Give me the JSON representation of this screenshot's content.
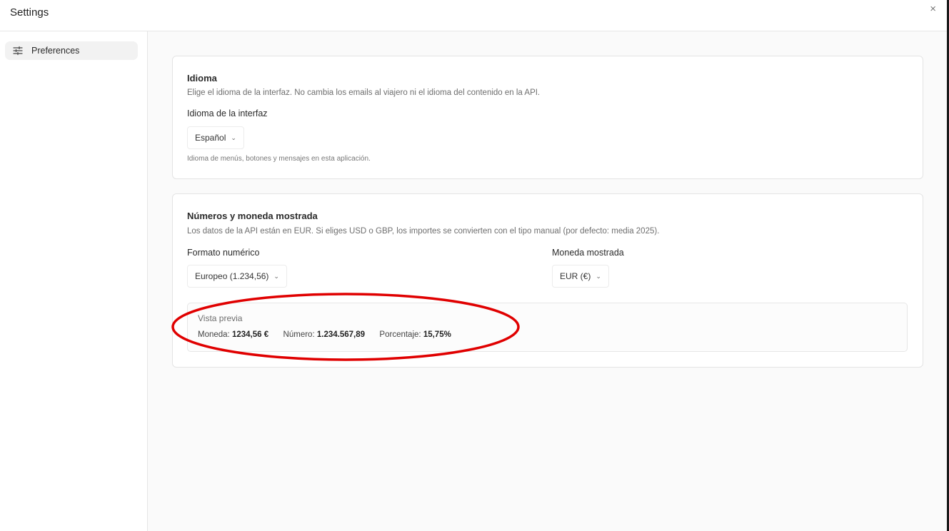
{
  "header": {
    "title": "Settings",
    "close_glyph": "×"
  },
  "sidebar": {
    "items": [
      {
        "label": "Preferences",
        "icon": "sliders-icon"
      }
    ]
  },
  "idioma": {
    "title": "Idioma",
    "description": "Elige el idioma de la interfaz. No cambia los emails al viajero ni el idioma del contenido en la API.",
    "field_label": "Idioma de la interfaz",
    "selected": "Español",
    "hint": "Idioma de menús, botones y mensajes en esta aplicación."
  },
  "numeros": {
    "title": "Números y moneda mostrada",
    "description": "Los datos de la API están en EUR. Si eliges USD o GBP, los importes se convierten con el tipo manual (por defecto: media 2025).",
    "format_label": "Formato numérico",
    "format_selected": "Europeo (1.234,56)",
    "currency_label": "Moneda mostrada",
    "currency_selected": "EUR (€)",
    "preview": {
      "title": "Vista previa",
      "currency_label": "Moneda:",
      "currency_value": "1234,56 €",
      "number_label": "Número:",
      "number_value": "1.234.567,89",
      "percent_label": "Porcentaje:",
      "percent_value": "15,75%"
    }
  },
  "colors": {
    "annotation": "#e00000"
  }
}
